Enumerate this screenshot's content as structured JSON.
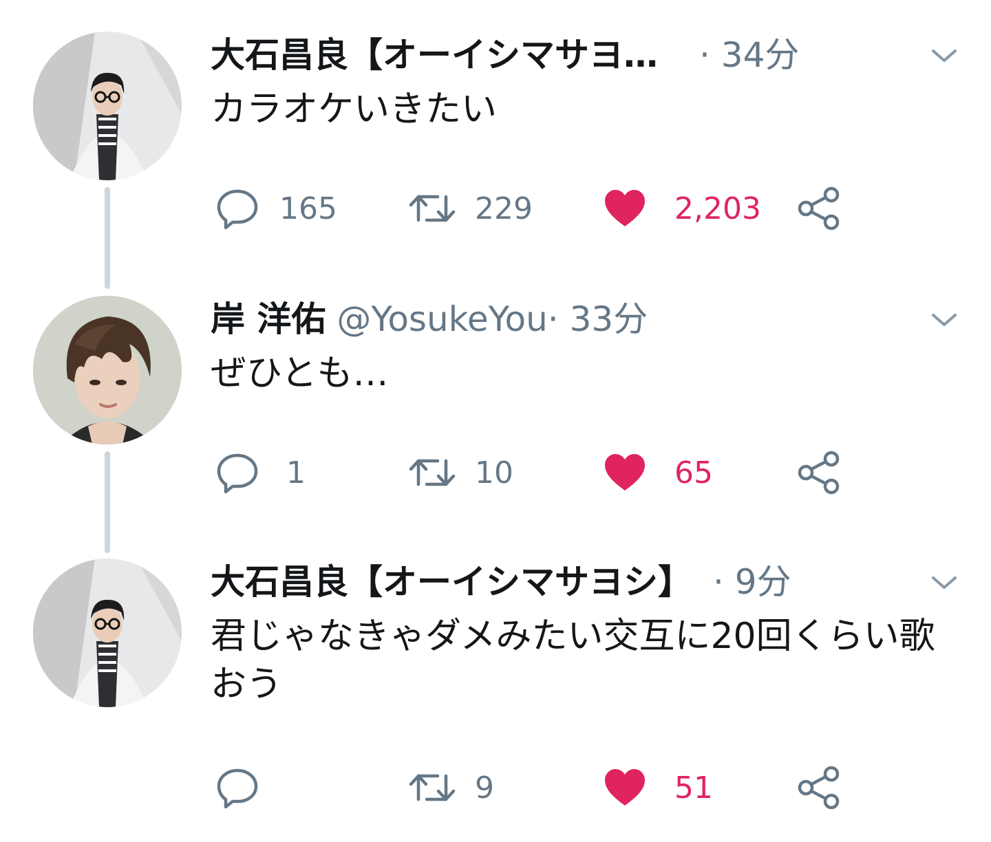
{
  "accent_like_color": "#e0245e",
  "muted_color": "#657786",
  "tweets": [
    {
      "avatar": "avatar-ooishi",
      "name": "大石昌良【オーイシマサヨ…",
      "handle": "",
      "time": " · 34分",
      "text": "カラオケいきたい",
      "reply_count": "165",
      "retweet_count": "229",
      "like_count": "2,203",
      "liked": true
    },
    {
      "avatar": "avatar-kishi",
      "name": "岸 洋佑",
      "handle": "@YosukeYou",
      "time": " · 33分",
      "text": "ぜひとも…",
      "reply_count": "1",
      "retweet_count": "10",
      "like_count": "65",
      "liked": true
    },
    {
      "avatar": "avatar-ooishi",
      "name": "大石昌良【オーイシマサヨシ】",
      "handle": "",
      "time": " · 9分",
      "text": "君じゃなきゃダメみたい交互に20回くらい歌おう",
      "reply_count": "",
      "retweet_count": "9",
      "like_count": "51",
      "liked": true
    }
  ]
}
